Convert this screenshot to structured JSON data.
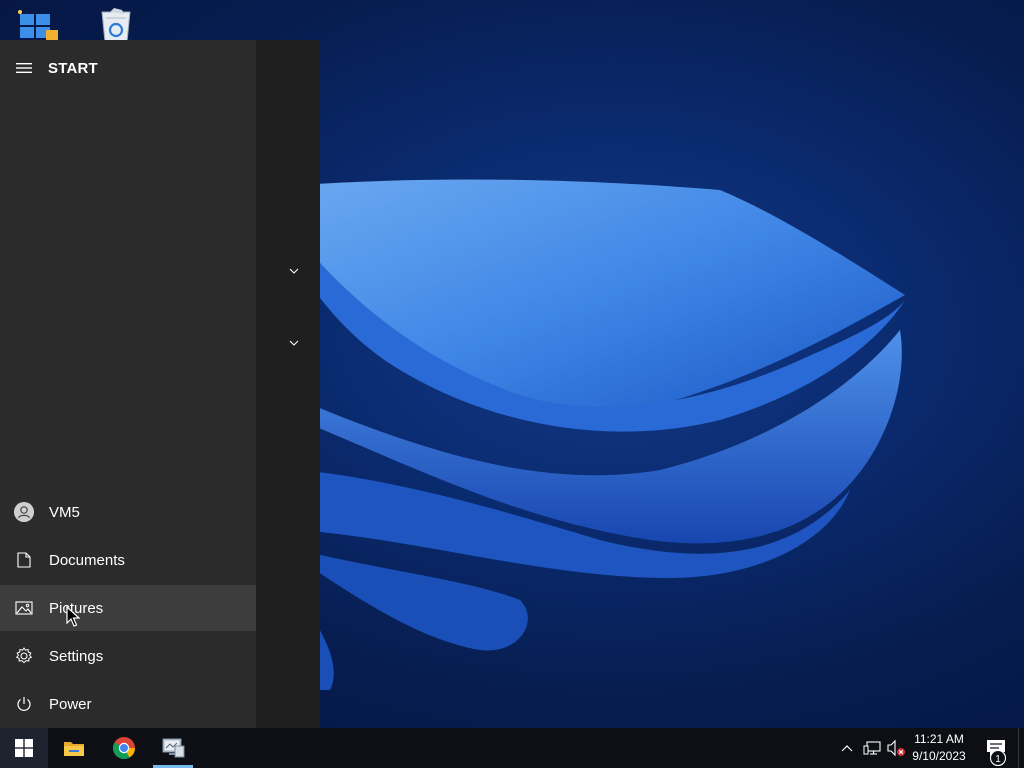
{
  "desktop": {
    "icons": [
      {
        "name": "windows-setup-icon"
      },
      {
        "name": "recycle-bin-icon"
      }
    ]
  },
  "start_menu": {
    "title": "START",
    "items": [
      {
        "label": "VM5",
        "icon": "user-avatar-icon"
      },
      {
        "label": "Documents",
        "icon": "document-icon"
      },
      {
        "label": "Pictures",
        "icon": "pictures-icon",
        "active": true
      },
      {
        "label": "Settings",
        "icon": "gear-icon"
      },
      {
        "label": "Power",
        "icon": "power-icon"
      }
    ]
  },
  "taskbar": {
    "apps": [
      {
        "name": "windows-start",
        "icon": "windows-logo-icon"
      },
      {
        "name": "file-explorer",
        "icon": "folder-icon"
      },
      {
        "name": "google-chrome",
        "icon": "chrome-icon"
      },
      {
        "name": "network-app",
        "icon": "monitor-app-icon",
        "active": true
      }
    ],
    "clock": {
      "time": "11:21 AM",
      "date": "9/10/2023"
    },
    "notification_count": "1"
  },
  "colors": {
    "start_bg": "#2b2b2b",
    "start_tiles_bg": "#1f1f1f",
    "active_item_bg": "#3d3d3d",
    "taskbar_bg": "#0d0f14",
    "accent": "#76b9ed",
    "wallpaper_blue": "#3b7fe0"
  }
}
